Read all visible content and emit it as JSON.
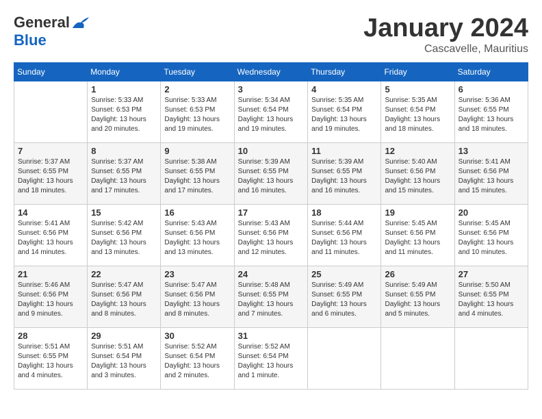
{
  "logo": {
    "general": "General",
    "blue": "Blue"
  },
  "title": {
    "month": "January 2024",
    "location": "Cascavelle, Mauritius"
  },
  "headers": [
    "Sunday",
    "Monday",
    "Tuesday",
    "Wednesday",
    "Thursday",
    "Friday",
    "Saturday"
  ],
  "weeks": [
    [
      {
        "day": "",
        "info": ""
      },
      {
        "day": "1",
        "info": "Sunrise: 5:33 AM\nSunset: 6:53 PM\nDaylight: 13 hours\nand 20 minutes."
      },
      {
        "day": "2",
        "info": "Sunrise: 5:33 AM\nSunset: 6:53 PM\nDaylight: 13 hours\nand 19 minutes."
      },
      {
        "day": "3",
        "info": "Sunrise: 5:34 AM\nSunset: 6:54 PM\nDaylight: 13 hours\nand 19 minutes."
      },
      {
        "day": "4",
        "info": "Sunrise: 5:35 AM\nSunset: 6:54 PM\nDaylight: 13 hours\nand 19 minutes."
      },
      {
        "day": "5",
        "info": "Sunrise: 5:35 AM\nSunset: 6:54 PM\nDaylight: 13 hours\nand 18 minutes."
      },
      {
        "day": "6",
        "info": "Sunrise: 5:36 AM\nSunset: 6:55 PM\nDaylight: 13 hours\nand 18 minutes."
      }
    ],
    [
      {
        "day": "7",
        "info": "Sunrise: 5:37 AM\nSunset: 6:55 PM\nDaylight: 13 hours\nand 18 minutes."
      },
      {
        "day": "8",
        "info": "Sunrise: 5:37 AM\nSunset: 6:55 PM\nDaylight: 13 hours\nand 17 minutes."
      },
      {
        "day": "9",
        "info": "Sunrise: 5:38 AM\nSunset: 6:55 PM\nDaylight: 13 hours\nand 17 minutes."
      },
      {
        "day": "10",
        "info": "Sunrise: 5:39 AM\nSunset: 6:55 PM\nDaylight: 13 hours\nand 16 minutes."
      },
      {
        "day": "11",
        "info": "Sunrise: 5:39 AM\nSunset: 6:55 PM\nDaylight: 13 hours\nand 16 minutes."
      },
      {
        "day": "12",
        "info": "Sunrise: 5:40 AM\nSunset: 6:56 PM\nDaylight: 13 hours\nand 15 minutes."
      },
      {
        "day": "13",
        "info": "Sunrise: 5:41 AM\nSunset: 6:56 PM\nDaylight: 13 hours\nand 15 minutes."
      }
    ],
    [
      {
        "day": "14",
        "info": "Sunrise: 5:41 AM\nSunset: 6:56 PM\nDaylight: 13 hours\nand 14 minutes."
      },
      {
        "day": "15",
        "info": "Sunrise: 5:42 AM\nSunset: 6:56 PM\nDaylight: 13 hours\nand 13 minutes."
      },
      {
        "day": "16",
        "info": "Sunrise: 5:43 AM\nSunset: 6:56 PM\nDaylight: 13 hours\nand 13 minutes."
      },
      {
        "day": "17",
        "info": "Sunrise: 5:43 AM\nSunset: 6:56 PM\nDaylight: 13 hours\nand 12 minutes."
      },
      {
        "day": "18",
        "info": "Sunrise: 5:44 AM\nSunset: 6:56 PM\nDaylight: 13 hours\nand 11 minutes."
      },
      {
        "day": "19",
        "info": "Sunrise: 5:45 AM\nSunset: 6:56 PM\nDaylight: 13 hours\nand 11 minutes."
      },
      {
        "day": "20",
        "info": "Sunrise: 5:45 AM\nSunset: 6:56 PM\nDaylight: 13 hours\nand 10 minutes."
      }
    ],
    [
      {
        "day": "21",
        "info": "Sunrise: 5:46 AM\nSunset: 6:56 PM\nDaylight: 13 hours\nand 9 minutes."
      },
      {
        "day": "22",
        "info": "Sunrise: 5:47 AM\nSunset: 6:56 PM\nDaylight: 13 hours\nand 8 minutes."
      },
      {
        "day": "23",
        "info": "Sunrise: 5:47 AM\nSunset: 6:56 PM\nDaylight: 13 hours\nand 8 minutes."
      },
      {
        "day": "24",
        "info": "Sunrise: 5:48 AM\nSunset: 6:55 PM\nDaylight: 13 hours\nand 7 minutes."
      },
      {
        "day": "25",
        "info": "Sunrise: 5:49 AM\nSunset: 6:55 PM\nDaylight: 13 hours\nand 6 minutes."
      },
      {
        "day": "26",
        "info": "Sunrise: 5:49 AM\nSunset: 6:55 PM\nDaylight: 13 hours\nand 5 minutes."
      },
      {
        "day": "27",
        "info": "Sunrise: 5:50 AM\nSunset: 6:55 PM\nDaylight: 13 hours\nand 4 minutes."
      }
    ],
    [
      {
        "day": "28",
        "info": "Sunrise: 5:51 AM\nSunset: 6:55 PM\nDaylight: 13 hours\nand 4 minutes."
      },
      {
        "day": "29",
        "info": "Sunrise: 5:51 AM\nSunset: 6:54 PM\nDaylight: 13 hours\nand 3 minutes."
      },
      {
        "day": "30",
        "info": "Sunrise: 5:52 AM\nSunset: 6:54 PM\nDaylight: 13 hours\nand 2 minutes."
      },
      {
        "day": "31",
        "info": "Sunrise: 5:52 AM\nSunset: 6:54 PM\nDaylight: 13 hours\nand 1 minute."
      },
      {
        "day": "",
        "info": ""
      },
      {
        "day": "",
        "info": ""
      },
      {
        "day": "",
        "info": ""
      }
    ]
  ]
}
